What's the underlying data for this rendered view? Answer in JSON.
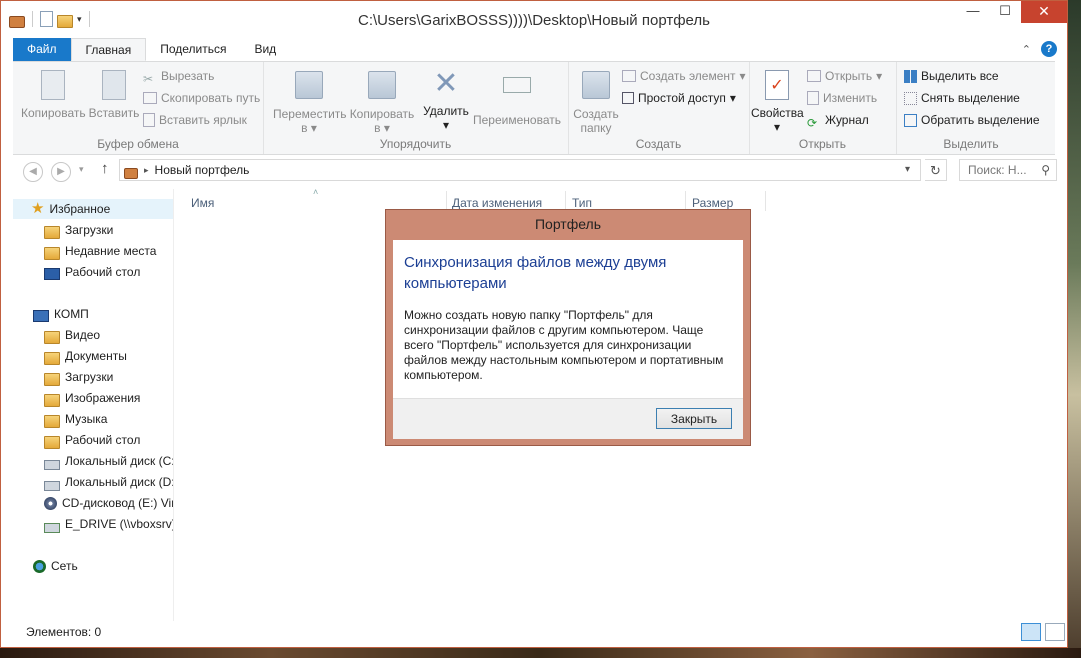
{
  "window": {
    "title": "C:\\Users\\GarixBOSSS))))\\Desktop\\Новый портфель"
  },
  "caption": {
    "minimize": "—",
    "maximize": "☐",
    "close": "✕"
  },
  "tabs": [
    "Файл",
    "Главная",
    "Поделиться",
    "Вид"
  ],
  "ribbon": {
    "clipboard": {
      "label": "Буфер обмена",
      "copy": "Копировать",
      "paste": "Вставить",
      "cut": "Вырезать",
      "copy_path": "Скопировать путь",
      "paste_shortcut": "Вставить ярлык"
    },
    "organize": {
      "label": "Упорядочить",
      "move_to": "Переместить",
      "copy_to": "Копировать",
      "to_suffix": "в",
      "delete": "Удалить",
      "rename": "Переименовать"
    },
    "create": {
      "label": "Создать",
      "new_folder_1": "Создать",
      "new_folder_2": "папку",
      "new_item": "Создать элемент",
      "easy_access": "Простой доступ"
    },
    "open": {
      "label": "Открыть",
      "properties": "Свойства",
      "open": "Открыть",
      "edit": "Изменить",
      "history": "Журнал"
    },
    "select": {
      "label": "Выделить",
      "select_all": "Выделить все",
      "select_none": "Снять выделение",
      "invert": "Обратить выделение"
    }
  },
  "address": {
    "crumb": "Новый портфель",
    "search_placeholder": "Поиск: Н..."
  },
  "nav": {
    "favorites": "Избранное",
    "fav_items": [
      "Загрузки",
      "Недавние места",
      "Рабочий стол"
    ],
    "computer": "КОМП",
    "comp_items": [
      "Видео",
      "Документы",
      "Загрузки",
      "Изображения",
      "Музыка",
      "Рабочий стол",
      "Локальный диск (C:",
      "Локальный диск (D:",
      "CD-дисковод (E:) Vir",
      "E_DRIVE (\\\\vboxsrv) ("
    ],
    "network": "Сеть"
  },
  "columns": [
    "Имя",
    "Дата изменения",
    "Тип",
    "Размер"
  ],
  "status": {
    "items": "Элементов: 0"
  },
  "dialog": {
    "title": "Портфель",
    "heading": "Синхронизация файлов между двумя компьютерами",
    "body": "Можно создать новую папку \"Портфель\" для синхронизации файлов с другим компьютером. Чаще всего \"Портфель\" используется для синхронизации файлов между настольным компьютером и портативным компьютером.",
    "close_button": "Закрыть"
  },
  "colors": {
    "accent": "#1979ca",
    "dialog_frame": "#cc8a74",
    "heading": "#1c3f94",
    "close_button": "#c7432e"
  }
}
